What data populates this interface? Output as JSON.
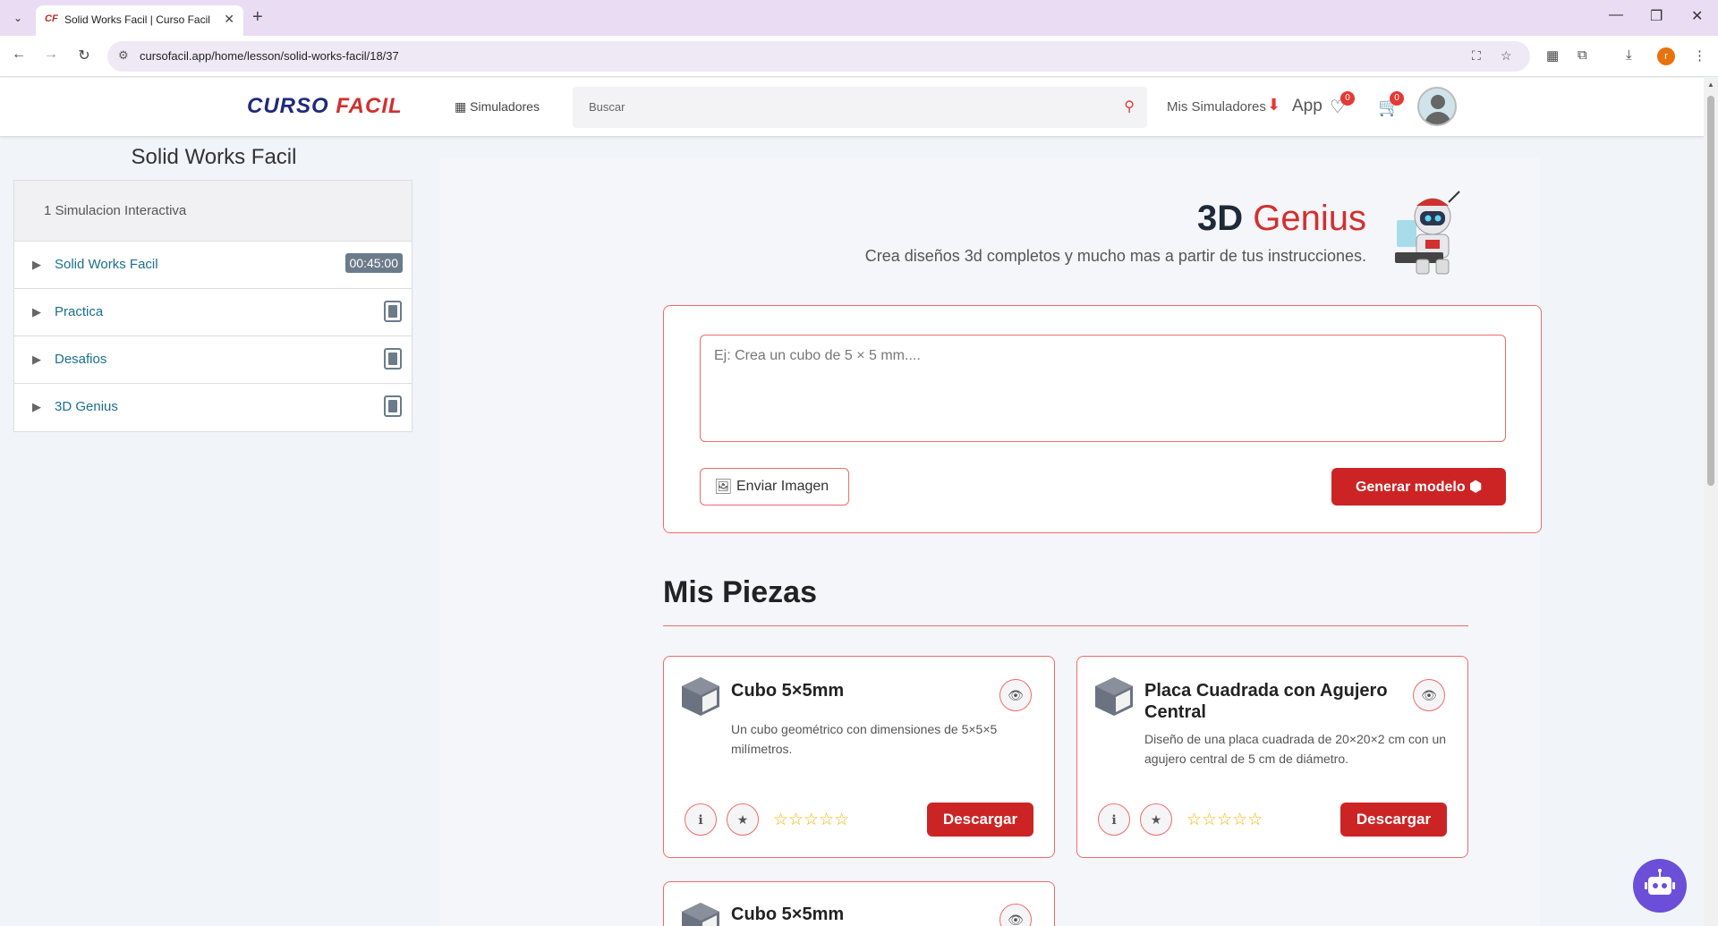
{
  "browser": {
    "tab_title": "Solid Works Facil | Curso Facil",
    "favicon_text": "CF",
    "url": "cursofacil.app/home/lesson/solid-works-facil/18/37",
    "profile_initial": "r"
  },
  "header": {
    "logo_part1": "CURSO ",
    "logo_part2": "FACIL",
    "simuladores_label": "Simuladores",
    "search_placeholder": "Buscar",
    "mis_simuladores_label": "Mis Simuladores",
    "app_label": "App",
    "favorites_count": "0",
    "cart_count": "0"
  },
  "sidebar": {
    "course_title": "Solid Works Facil",
    "section_title": "1 Simulacion Interactiva",
    "items": [
      {
        "label": "Solid Works Facil",
        "time": "00:45:00"
      },
      {
        "label": "Practica"
      },
      {
        "label": "Desafios"
      },
      {
        "label": "3D Genius"
      }
    ]
  },
  "genius": {
    "title_part1": "3D ",
    "title_part2": "Genius",
    "subtitle": "Crea diseños 3d completos y mucho mas a partir de tus instrucciones.",
    "prompt_placeholder": "Ej: Crea un cubo de 5 × 5 mm....",
    "send_image_label": "Enviar Imagen",
    "generate_label": "Generar modelo"
  },
  "pieces": {
    "title": "Mis Piezas",
    "download_label": "Descargar",
    "items": [
      {
        "name": "Cubo 5×5mm",
        "description": "Un cubo geométrico con dimensiones de 5×5×5 milímetros.",
        "rating": 0
      },
      {
        "name": "Placa Cuadrada con Agujero Central",
        "description": "Diseño de una placa cuadrada de 20×20×2 cm con un agujero central de 5 cm de diámetro.",
        "rating": 0
      },
      {
        "name": "Cubo 5×5mm"
      }
    ]
  },
  "colors": {
    "accent_red": "#cc2424",
    "border_red": "#ef6b6b",
    "link_blue": "#1a6f8f",
    "chat_purple": "#6b4fd8"
  }
}
